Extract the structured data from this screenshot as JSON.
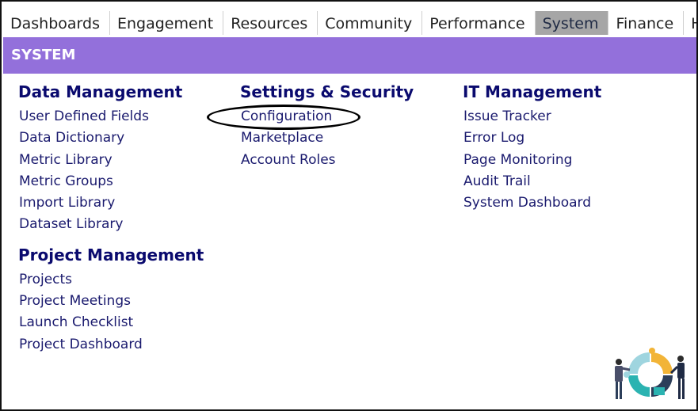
{
  "topnav": {
    "tabs": [
      {
        "label": "Dashboards"
      },
      {
        "label": "Engagement"
      },
      {
        "label": "Resources"
      },
      {
        "label": "Community"
      },
      {
        "label": "Performance"
      },
      {
        "label": "System",
        "active": true
      },
      {
        "label": "Finance"
      },
      {
        "label": "Help"
      }
    ]
  },
  "banner": {
    "title": "SYSTEM"
  },
  "columns": {
    "data_management": {
      "title": "Data Management",
      "items": [
        "User Defined Fields",
        "Data Dictionary",
        "Metric Library",
        "Metric Groups",
        "Import Library",
        "Dataset Library"
      ]
    },
    "project_management": {
      "title": "Project Management",
      "items": [
        "Projects",
        "Project Meetings",
        "Launch Checklist",
        "Project Dashboard"
      ]
    },
    "settings_security": {
      "title": "Settings & Security",
      "items": [
        "Configuration",
        "Marketplace",
        "Account Roles"
      ]
    },
    "it_management": {
      "title": "IT Management",
      "items": [
        "Issue Tracker",
        "Error Log",
        "Page Monitoring",
        "Audit Trail",
        "System Dashboard"
      ]
    }
  },
  "colors": {
    "banner": "#9370db",
    "active_tab": "#a6a6a6",
    "heading": "#0a0a6e"
  }
}
